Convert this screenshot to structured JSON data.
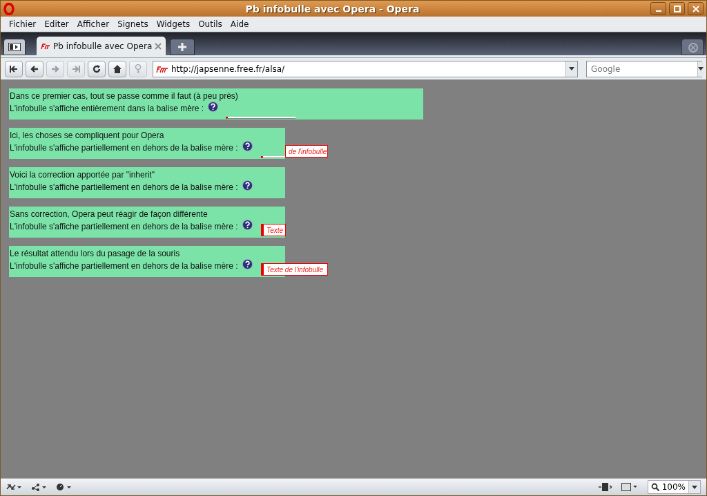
{
  "window": {
    "title": "Pb infobulle avec Opera - Opera"
  },
  "menu": [
    {
      "label": "Fichier"
    },
    {
      "label": "Editer"
    },
    {
      "label": "Afficher"
    },
    {
      "label": "Signets"
    },
    {
      "label": "Widgets"
    },
    {
      "label": "Outils"
    },
    {
      "label": "Aide"
    }
  ],
  "tabs": [
    {
      "label": "Pb infobulle avec Opera",
      "selected": true
    }
  ],
  "address": {
    "value": "http://japsenne.free.fr/alsa/"
  },
  "search": {
    "placeholder": "Google"
  },
  "demos": [
    {
      "title": "Dans ce premier cas, tout se passe comme il faut (à peu près)",
      "label": "L'infobulle s'affiche entièrement dans la balise mère :",
      "wide": true,
      "tooltip": {
        "kind": "line"
      }
    },
    {
      "title": "Ici, les choses se compliquent pour Opera",
      "label": "L'infobulle s'affiche partiellement en dehors de la balise mère :",
      "wide": false,
      "tooltip": {
        "kind": "partial",
        "text": "de l'infobulle"
      }
    },
    {
      "title": "Voici la correction apportée par \"inherit\"",
      "label": "L'infobulle s'affiche partiellement en dehors de la balise mère :",
      "wide": false,
      "tooltip": {
        "kind": "none"
      }
    },
    {
      "title": "Sans correction, Opera peut réagir de façon différente",
      "label": "L'infobulle s'affiche partiellement en dehors de la balise mère :",
      "wide": false,
      "tooltip": {
        "kind": "clipped",
        "text": "Texte"
      }
    },
    {
      "title": "Le résultat attendu lors du pasage de la souris",
      "label": "L'infobulle s'affiche partiellement en dehors de la balise mère :",
      "wide": false,
      "tooltip": {
        "kind": "full",
        "text": "Texte de l'infobulle"
      }
    }
  ],
  "status_bar": {
    "zoom": "100%"
  }
}
